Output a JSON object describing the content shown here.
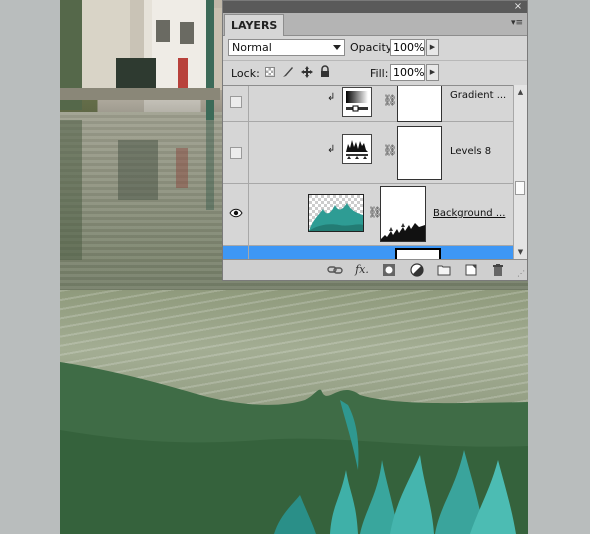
{
  "panel": {
    "tab_label": "LAYERS",
    "close_glyph": "×",
    "menu_glyph": "▾≡"
  },
  "blend": {
    "mode": "Normal"
  },
  "opacity": {
    "label": "Opacity:",
    "value": "100%"
  },
  "lock": {
    "label": "Lock:"
  },
  "fill": {
    "label": "Fill:",
    "value": "100%"
  },
  "layers": [
    {
      "name": "Gradient ...",
      "visible": false,
      "clipped": true,
      "type": "adjustment-gradient"
    },
    {
      "name": "Levels 8",
      "visible": false,
      "clipped": true,
      "type": "adjustment-levels"
    },
    {
      "name": "Background ...",
      "visible": true,
      "clipped": false,
      "type": "image-with-mask"
    },
    {
      "name": "",
      "visible": true,
      "clipped": false,
      "type": "selected",
      "selected": true
    }
  ],
  "icons": {
    "eye": "eye-icon",
    "chain": "chain-icon",
    "link": "link-layers-icon",
    "fx": "fx-icon",
    "mask": "add-mask-icon",
    "adjustment": "adjustment-layer-icon",
    "group": "folder-icon",
    "new_layer": "new-layer-icon",
    "delete": "trash-icon"
  },
  "colors": {
    "selection": "#3e97f5",
    "panel": "#d6d6d6",
    "canvas_bg": "#b9bdbd"
  }
}
